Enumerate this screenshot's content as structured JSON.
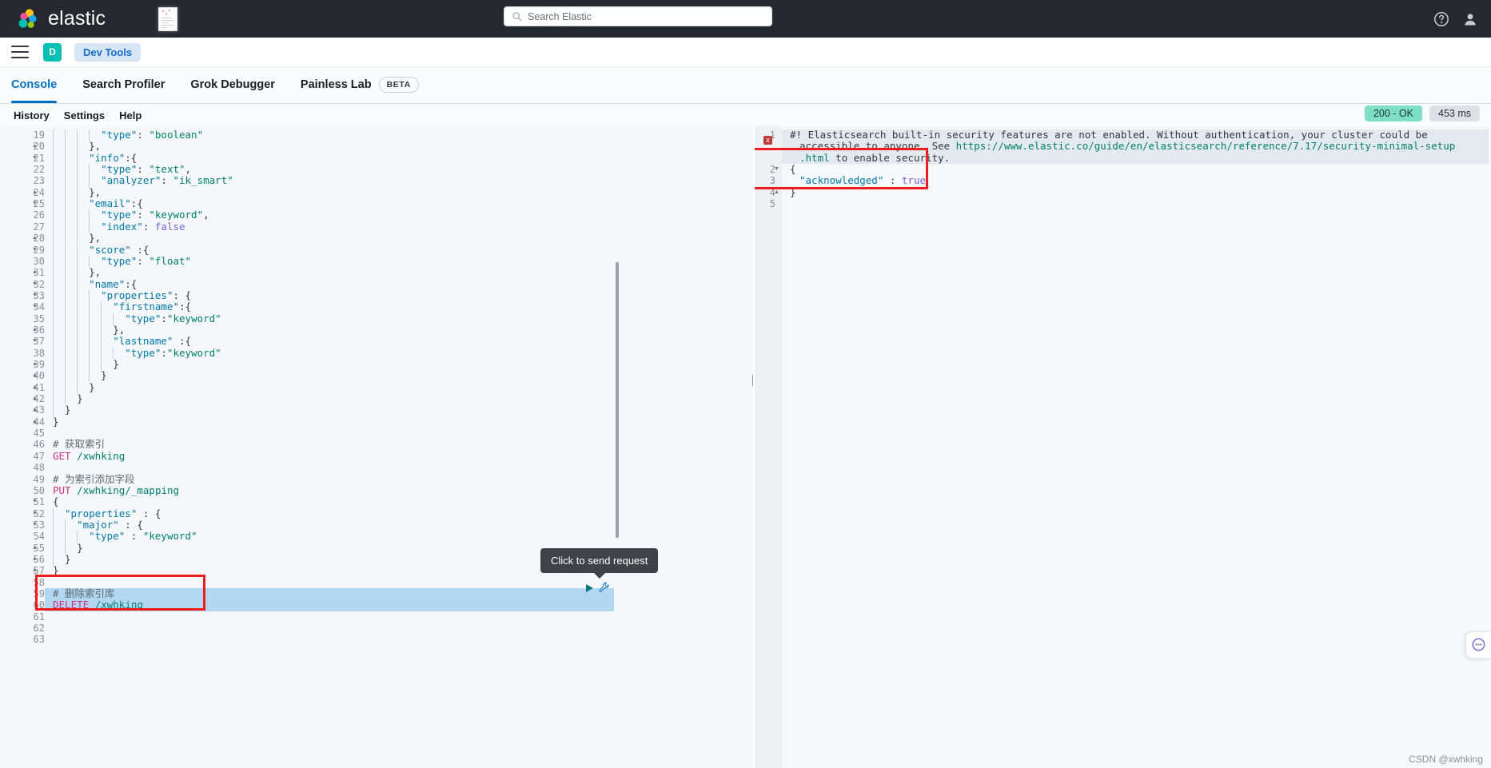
{
  "topbar": {
    "brand": "elastic",
    "brand_icon": "elastic-logo-icon",
    "thumbnail_icon": "document-thumbnail-icon",
    "search": {
      "placeholder": "Search Elastic",
      "icon": "search-icon",
      "value": ""
    },
    "right_icons": [
      {
        "name": "help-icon",
        "label": "Help"
      },
      {
        "name": "user-avatar-icon",
        "label": "User"
      }
    ]
  },
  "navbar": {
    "menu_icon": "hamburger-menu-icon",
    "space_initial": "D",
    "breadcrumb": "Dev Tools"
  },
  "tabs": [
    {
      "label": "Console",
      "active": true,
      "badge": ""
    },
    {
      "label": "Search Profiler",
      "active": false,
      "badge": ""
    },
    {
      "label": "Grok Debugger",
      "active": false,
      "badge": ""
    },
    {
      "label": "Painless Lab",
      "active": false,
      "badge": "BETA"
    }
  ],
  "actions": [
    "History",
    "Settings",
    "Help"
  ],
  "status": {
    "code": "200 - OK",
    "time": "453 ms",
    "ok_color": "#7fdfc4",
    "time_color": "#dde0e7"
  },
  "tooltip": {
    "text": "Click to send request"
  },
  "run_controls": {
    "play_icon": "play-triangle-icon",
    "wrench_icon": "wrench-icon"
  },
  "editor": {
    "first_line": 19,
    "lines": [
      {
        "n": 19,
        "fold": "",
        "indent": 5,
        "tokens": [
          {
            "t": "\"type\"",
            "c": "k"
          },
          {
            "t": ": ",
            "c": "p"
          },
          {
            "t": "\"boolean\"",
            "c": "s"
          }
        ]
      },
      {
        "n": 20,
        "fold": "▲",
        "indent": 4,
        "tokens": [
          {
            "t": "},",
            "c": "p"
          }
        ]
      },
      {
        "n": 21,
        "fold": "▼",
        "indent": 4,
        "tokens": [
          {
            "t": "\"info\"",
            "c": "k"
          },
          {
            "t": ":{",
            "c": "p"
          }
        ]
      },
      {
        "n": 22,
        "fold": "",
        "indent": 5,
        "tokens": [
          {
            "t": "\"type\"",
            "c": "k"
          },
          {
            "t": ": ",
            "c": "p"
          },
          {
            "t": "\"text\"",
            "c": "s"
          },
          {
            "t": ",",
            "c": "p"
          }
        ]
      },
      {
        "n": 23,
        "fold": "",
        "indent": 5,
        "tokens": [
          {
            "t": "\"analyzer\"",
            "c": "k"
          },
          {
            "t": ": ",
            "c": "p"
          },
          {
            "t": "\"ik_smart\"",
            "c": "s"
          }
        ]
      },
      {
        "n": 24,
        "fold": "▲",
        "indent": 4,
        "tokens": [
          {
            "t": "},",
            "c": "p"
          }
        ]
      },
      {
        "n": 25,
        "fold": "▼",
        "indent": 4,
        "tokens": [
          {
            "t": "\"email\"",
            "c": "k"
          },
          {
            "t": ":{",
            "c": "p"
          }
        ]
      },
      {
        "n": 26,
        "fold": "",
        "indent": 5,
        "tokens": [
          {
            "t": "\"type\"",
            "c": "k"
          },
          {
            "t": ": ",
            "c": "p"
          },
          {
            "t": "\"keyword\"",
            "c": "s"
          },
          {
            "t": ",",
            "c": "p"
          }
        ]
      },
      {
        "n": 27,
        "fold": "",
        "indent": 5,
        "tokens": [
          {
            "t": "\"index\"",
            "c": "k"
          },
          {
            "t": ": ",
            "c": "p"
          },
          {
            "t": "false",
            "c": "n"
          }
        ]
      },
      {
        "n": 28,
        "fold": "▲",
        "indent": 4,
        "tokens": [
          {
            "t": "},",
            "c": "p"
          }
        ]
      },
      {
        "n": 29,
        "fold": "▼",
        "indent": 4,
        "tokens": [
          {
            "t": "\"score\"",
            "c": "k"
          },
          {
            "t": " :{",
            "c": "p"
          }
        ]
      },
      {
        "n": 30,
        "fold": "",
        "indent": 5,
        "tokens": [
          {
            "t": "\"type\"",
            "c": "k"
          },
          {
            "t": ": ",
            "c": "p"
          },
          {
            "t": "\"float\"",
            "c": "s"
          }
        ]
      },
      {
        "n": 31,
        "fold": "▲",
        "indent": 4,
        "tokens": [
          {
            "t": "},",
            "c": "p"
          }
        ]
      },
      {
        "n": 32,
        "fold": "▼",
        "indent": 4,
        "tokens": [
          {
            "t": "\"name\"",
            "c": "k"
          },
          {
            "t": ":{",
            "c": "p"
          }
        ]
      },
      {
        "n": 33,
        "fold": "▼",
        "indent": 5,
        "tokens": [
          {
            "t": "\"properties\"",
            "c": "k"
          },
          {
            "t": ": {",
            "c": "p"
          }
        ]
      },
      {
        "n": 34,
        "fold": "▼",
        "indent": 6,
        "tokens": [
          {
            "t": "\"firstname\"",
            "c": "k"
          },
          {
            "t": ":{",
            "c": "p"
          }
        ]
      },
      {
        "n": 35,
        "fold": "",
        "indent": 7,
        "tokens": [
          {
            "t": "\"type\"",
            "c": "k"
          },
          {
            "t": ":",
            "c": "p"
          },
          {
            "t": "\"keyword\"",
            "c": "s"
          }
        ]
      },
      {
        "n": 36,
        "fold": "▲",
        "indent": 6,
        "tokens": [
          {
            "t": "},",
            "c": "p"
          }
        ]
      },
      {
        "n": 37,
        "fold": "▼",
        "indent": 6,
        "tokens": [
          {
            "t": "\"lastname\"",
            "c": "k"
          },
          {
            "t": " :{",
            "c": "p"
          }
        ]
      },
      {
        "n": 38,
        "fold": "",
        "indent": 7,
        "tokens": [
          {
            "t": "\"type\"",
            "c": "k"
          },
          {
            "t": ":",
            "c": "p"
          },
          {
            "t": "\"keyword\"",
            "c": "s"
          }
        ]
      },
      {
        "n": 39,
        "fold": "▲",
        "indent": 6,
        "tokens": [
          {
            "t": "}",
            "c": "p"
          }
        ]
      },
      {
        "n": 40,
        "fold": "▲",
        "indent": 5,
        "tokens": [
          {
            "t": "}",
            "c": "p"
          }
        ]
      },
      {
        "n": 41,
        "fold": "▲",
        "indent": 4,
        "tokens": [
          {
            "t": "}",
            "c": "p"
          }
        ]
      },
      {
        "n": 42,
        "fold": "▲",
        "indent": 3,
        "tokens": [
          {
            "t": "}",
            "c": "p"
          }
        ]
      },
      {
        "n": 43,
        "fold": "▲",
        "indent": 2,
        "tokens": [
          {
            "t": "}",
            "c": "p"
          }
        ]
      },
      {
        "n": 44,
        "fold": "▲",
        "indent": 1,
        "tokens": [
          {
            "t": "}",
            "c": "p"
          }
        ]
      },
      {
        "n": 45,
        "fold": "",
        "indent": 1,
        "tokens": []
      },
      {
        "n": 46,
        "fold": "",
        "indent": 1,
        "tokens": [
          {
            "t": "# 获取索引",
            "c": "cm"
          }
        ]
      },
      {
        "n": 47,
        "fold": "",
        "indent": 1,
        "tokens": [
          {
            "t": "GET",
            "c": "mth"
          },
          {
            "t": " ",
            "c": "p"
          },
          {
            "t": "/xwhking",
            "c": "pth"
          }
        ]
      },
      {
        "n": 48,
        "fold": "",
        "indent": 1,
        "tokens": []
      },
      {
        "n": 49,
        "fold": "",
        "indent": 1,
        "tokens": [
          {
            "t": "# 为索引添加字段",
            "c": "cm"
          }
        ]
      },
      {
        "n": 50,
        "fold": "",
        "indent": 1,
        "tokens": [
          {
            "t": "PUT",
            "c": "mth"
          },
          {
            "t": " ",
            "c": "p"
          },
          {
            "t": "/xwhking/_mapping",
            "c": "pth"
          }
        ]
      },
      {
        "n": 51,
        "fold": "▼",
        "indent": 1,
        "tokens": [
          {
            "t": "{",
            "c": "p"
          }
        ]
      },
      {
        "n": 52,
        "fold": "▼",
        "indent": 2,
        "tokens": [
          {
            "t": "\"properties\"",
            "c": "k"
          },
          {
            "t": " : {",
            "c": "p"
          }
        ]
      },
      {
        "n": 53,
        "fold": "▼",
        "indent": 3,
        "tokens": [
          {
            "t": "\"major\"",
            "c": "k"
          },
          {
            "t": " : {",
            "c": "p"
          }
        ]
      },
      {
        "n": 54,
        "fold": "",
        "indent": 4,
        "tokens": [
          {
            "t": "\"type\"",
            "c": "k"
          },
          {
            "t": " : ",
            "c": "p"
          },
          {
            "t": "\"keyword\"",
            "c": "s"
          }
        ]
      },
      {
        "n": 55,
        "fold": "▲",
        "indent": 3,
        "tokens": [
          {
            "t": "}",
            "c": "p"
          }
        ]
      },
      {
        "n": 56,
        "fold": "▲",
        "indent": 2,
        "tokens": [
          {
            "t": "}",
            "c": "p"
          }
        ]
      },
      {
        "n": 57,
        "fold": "▲",
        "indent": 1,
        "tokens": [
          {
            "t": "}",
            "c": "p"
          }
        ]
      },
      {
        "n": 58,
        "fold": "",
        "indent": 1,
        "tokens": []
      },
      {
        "n": 59,
        "fold": "",
        "indent": 1,
        "tokens": [
          {
            "t": "# 删除索引库",
            "c": "cm"
          }
        ]
      },
      {
        "n": 60,
        "fold": "",
        "indent": 1,
        "tokens": [
          {
            "t": "DELETE",
            "c": "mth"
          },
          {
            "t": " ",
            "c": "p"
          },
          {
            "t": "/xwhking",
            "c": "pth"
          }
        ]
      },
      {
        "n": 61,
        "fold": "",
        "indent": 1,
        "tokens": []
      },
      {
        "n": 62,
        "fold": "",
        "indent": 1,
        "tokens": []
      },
      {
        "n": 63,
        "fold": "",
        "indent": 1,
        "tokens": []
      }
    ],
    "selection": {
      "from_line": 59,
      "to_line": 60
    },
    "annotation_box": {
      "label": "red-highlight-delete-request"
    }
  },
  "response": {
    "error_marker": "x",
    "lines": [
      {
        "n": "1",
        "fold": "",
        "text": "#! Elasticsearch built-in security features are not enabled. Without authentication, your cluster could be",
        "cls": "warn"
      },
      {
        "n": "",
        "fold": "",
        "text": "accessible to anyone. See https://www.elastic.co/guide/en/elasticsearch/reference/7.17/security-minimal-setup",
        "cls": "warn2"
      },
      {
        "n": "",
        "fold": "",
        "text": ".html to enable security.",
        "cls": "warn3"
      },
      {
        "n": "2",
        "fold": "▼",
        "text": "{",
        "cls": "p"
      },
      {
        "n": "3",
        "fold": "",
        "text": "\"acknowledged\" : true",
        "cls": "kv"
      },
      {
        "n": "4",
        "fold": "▲",
        "text": "}",
        "cls": "p"
      },
      {
        "n": "5",
        "fold": "",
        "text": "",
        "cls": "p"
      }
    ],
    "acknowledged_key": "\"acknowledged\"",
    "acknowledged_sep": " : ",
    "acknowledged_val": "true",
    "annotation_box": {
      "label": "red-highlight-response"
    }
  },
  "chat_button": {
    "icon": "chat-bubble-icon"
  },
  "watermark": "CSDN @xwhking"
}
